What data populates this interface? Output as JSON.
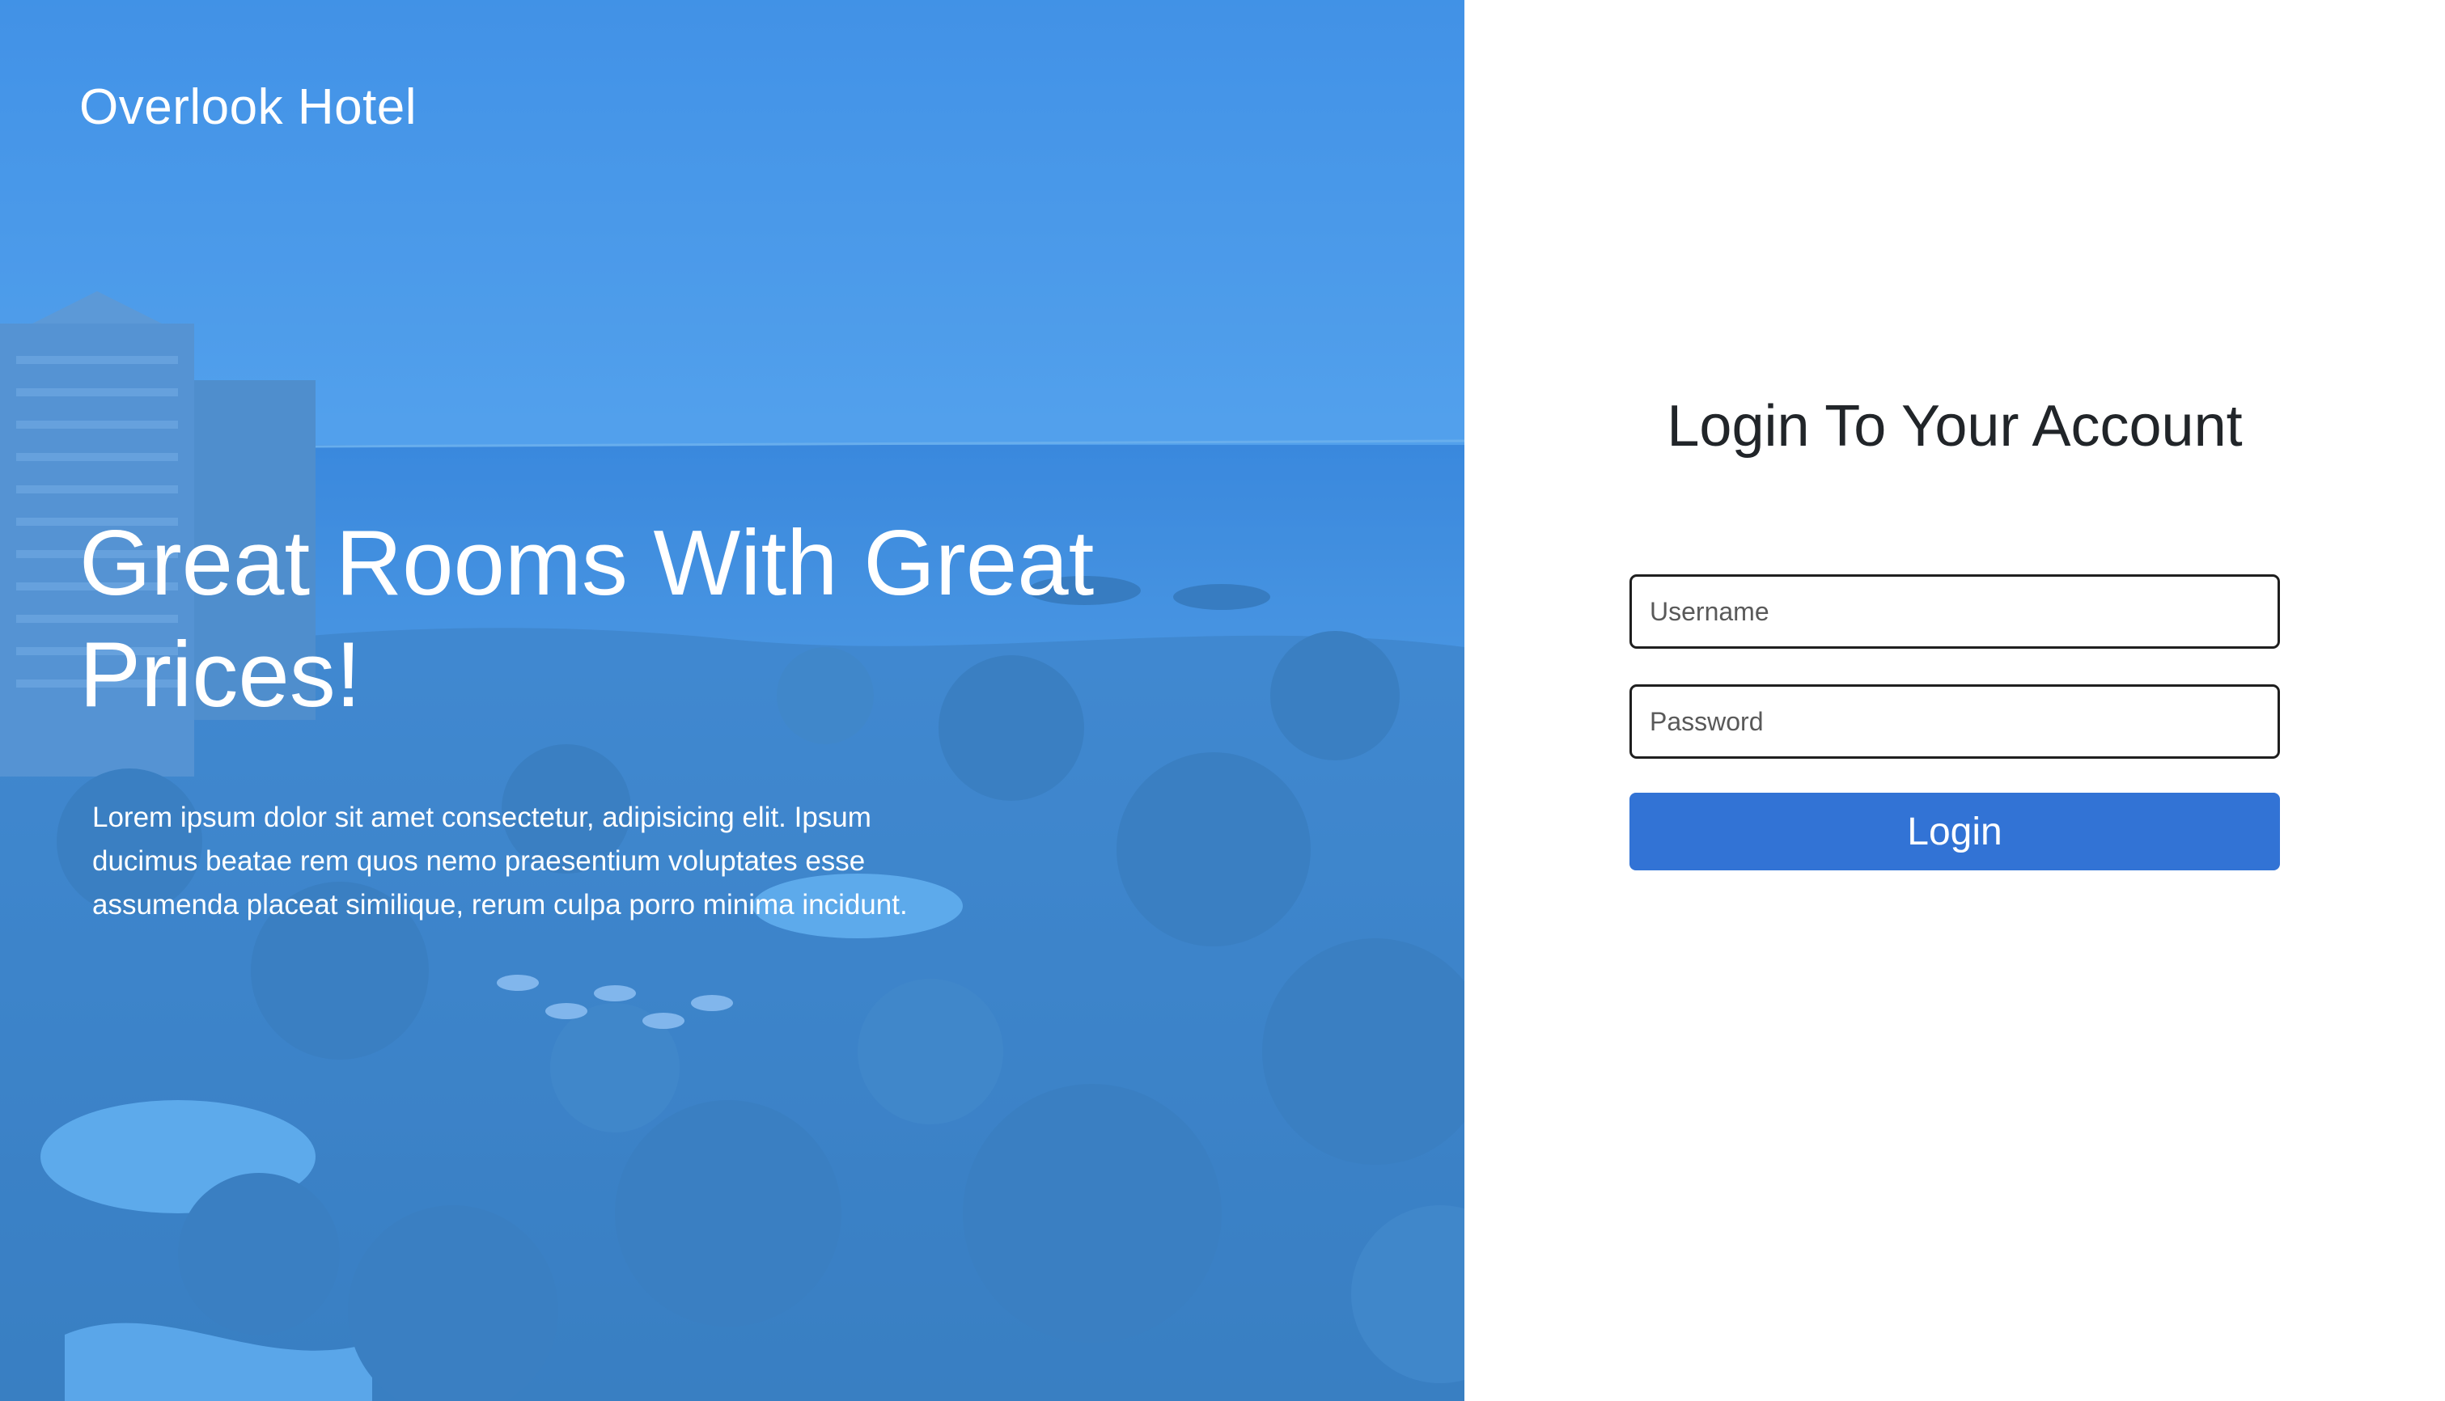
{
  "hero": {
    "brand": "Overlook Hotel",
    "headline": "Great Rooms With Great Prices!",
    "blurb": "Lorem ipsum dolor sit amet consectetur, adipisicing elit. Ipsum ducimus beatae rem quos nemo praesentium voluptates esse assumenda placeat similique, rerum culpa porro minima incidunt."
  },
  "login": {
    "title": "Login To Your Account",
    "username_placeholder": "Username",
    "password_placeholder": "Password",
    "submit_label": "Login"
  },
  "colors": {
    "hero_tint": "#4597e9",
    "button": "#3273d5",
    "title_text": "#212529"
  }
}
